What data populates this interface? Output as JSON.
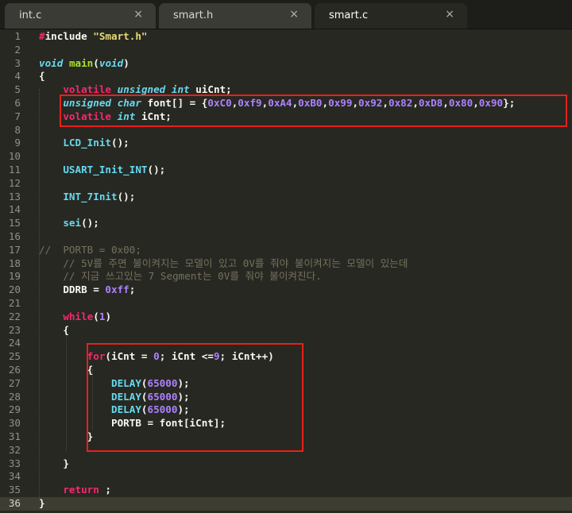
{
  "tabs": [
    {
      "label": "int.c",
      "close": "×"
    },
    {
      "label": "smart.h",
      "close": "×"
    },
    {
      "label": "smart.c",
      "close": "×",
      "active": true
    }
  ],
  "editor": {
    "current_line": 36,
    "lines": [
      {
        "n": "1",
        "t": [
          [
            "#",
            "kw"
          ],
          [
            "include ",
            ""
          ],
          [
            "\"Smart.h\"",
            "str"
          ]
        ]
      },
      {
        "n": "2",
        "t": []
      },
      {
        "n": "3",
        "t": [
          [
            "void",
            "ty"
          ],
          [
            " ",
            ""
          ],
          [
            "main",
            "fn"
          ],
          [
            "(",
            ""
          ],
          [
            "void",
            "ty"
          ],
          [
            ")",
            ""
          ]
        ]
      },
      {
        "n": "4",
        "t": [
          [
            "{",
            ""
          ]
        ]
      },
      {
        "n": "5",
        "t": [
          [
            "    ",
            ""
          ],
          [
            "volatile",
            "kw"
          ],
          [
            " ",
            ""
          ],
          [
            "unsigned",
            "ty"
          ],
          [
            " ",
            ""
          ],
          [
            "int",
            "ty"
          ],
          [
            " uiCnt;",
            ""
          ]
        ]
      },
      {
        "n": "6",
        "t": [
          [
            "    ",
            ""
          ],
          [
            "unsigned",
            "ty"
          ],
          [
            " ",
            ""
          ],
          [
            "char",
            "ty"
          ],
          [
            " font[] = {",
            ""
          ],
          [
            "0xC0",
            "num"
          ],
          [
            ",",
            ""
          ],
          [
            "0xf9",
            "num"
          ],
          [
            ",",
            ""
          ],
          [
            "0xA4",
            "num"
          ],
          [
            ",",
            ""
          ],
          [
            "0xB0",
            "num"
          ],
          [
            ",",
            ""
          ],
          [
            "0x99",
            "num"
          ],
          [
            ",",
            ""
          ],
          [
            "0x92",
            "num"
          ],
          [
            ",",
            ""
          ],
          [
            "0x82",
            "num"
          ],
          [
            ",",
            ""
          ],
          [
            "0xD8",
            "num"
          ],
          [
            ",",
            ""
          ],
          [
            "0x80",
            "num"
          ],
          [
            ",",
            ""
          ],
          [
            "0x90",
            "num"
          ],
          [
            "};",
            ""
          ]
        ]
      },
      {
        "n": "7",
        "t": [
          [
            "    ",
            ""
          ],
          [
            "volatile",
            "kw"
          ],
          [
            " ",
            ""
          ],
          [
            "int",
            "ty"
          ],
          [
            " iCnt;",
            ""
          ]
        ]
      },
      {
        "n": "8",
        "t": []
      },
      {
        "n": "9",
        "t": [
          [
            "    ",
            ""
          ],
          [
            "LCD_Init",
            "fn2"
          ],
          [
            "();",
            ""
          ]
        ]
      },
      {
        "n": "10",
        "t": []
      },
      {
        "n": "11",
        "t": [
          [
            "    ",
            ""
          ],
          [
            "USART_Init_INT",
            "fn2"
          ],
          [
            "();",
            ""
          ]
        ]
      },
      {
        "n": "12",
        "t": []
      },
      {
        "n": "13",
        "t": [
          [
            "    ",
            ""
          ],
          [
            "INT_7Init",
            "fn2"
          ],
          [
            "();",
            ""
          ]
        ]
      },
      {
        "n": "14",
        "t": []
      },
      {
        "n": "15",
        "t": [
          [
            "    ",
            ""
          ],
          [
            "sei",
            "fn2"
          ],
          [
            "();",
            ""
          ]
        ]
      },
      {
        "n": "16",
        "t": []
      },
      {
        "n": "17",
        "t": [
          [
            "//  PORTB = 0x00;",
            "cm"
          ]
        ]
      },
      {
        "n": "18",
        "t": [
          [
            "    // 5V를 주면 불이켜지는 모델이 있고 0V를 줘야 불이켜지는 모델이 있는데",
            "cm"
          ]
        ]
      },
      {
        "n": "19",
        "t": [
          [
            "    // 지금 쓰고있는 7 Segment는 0V를 줘야 불이켜진다.",
            "cm"
          ]
        ]
      },
      {
        "n": "20",
        "t": [
          [
            "    DDRB = ",
            ""
          ],
          [
            "0xff",
            "num"
          ],
          [
            ";",
            ""
          ]
        ]
      },
      {
        "n": "21",
        "t": []
      },
      {
        "n": "22",
        "t": [
          [
            "    ",
            ""
          ],
          [
            "while",
            "kw"
          ],
          [
            "(",
            ""
          ],
          [
            "1",
            "num"
          ],
          [
            ")",
            ""
          ]
        ]
      },
      {
        "n": "23",
        "t": [
          [
            "    {",
            ""
          ]
        ]
      },
      {
        "n": "24",
        "t": []
      },
      {
        "n": "25",
        "t": [
          [
            "        ",
            ""
          ],
          [
            "for",
            "kw"
          ],
          [
            "(iCnt = ",
            ""
          ],
          [
            "0",
            "num"
          ],
          [
            "; iCnt <=",
            ""
          ],
          [
            "9",
            "num"
          ],
          [
            "; iCnt++)",
            ""
          ]
        ]
      },
      {
        "n": "26",
        "t": [
          [
            "        {",
            ""
          ]
        ]
      },
      {
        "n": "27",
        "t": [
          [
            "            ",
            ""
          ],
          [
            "DELAY",
            "fn2"
          ],
          [
            "(",
            ""
          ],
          [
            "65000",
            "num"
          ],
          [
            ");",
            ""
          ]
        ]
      },
      {
        "n": "28",
        "t": [
          [
            "            ",
            ""
          ],
          [
            "DELAY",
            "fn2"
          ],
          [
            "(",
            ""
          ],
          [
            "65000",
            "num"
          ],
          [
            ");",
            ""
          ]
        ]
      },
      {
        "n": "29",
        "t": [
          [
            "            ",
            ""
          ],
          [
            "DELAY",
            "fn2"
          ],
          [
            "(",
            ""
          ],
          [
            "65000",
            "num"
          ],
          [
            ");",
            ""
          ]
        ]
      },
      {
        "n": "30",
        "t": [
          [
            "            PORTB = font[iCnt];",
            ""
          ]
        ]
      },
      {
        "n": "31",
        "t": [
          [
            "        }",
            ""
          ]
        ]
      },
      {
        "n": "32",
        "t": []
      },
      {
        "n": "33",
        "t": [
          [
            "    }",
            ""
          ]
        ]
      },
      {
        "n": "34",
        "t": []
      },
      {
        "n": "35",
        "t": [
          [
            "    ",
            ""
          ],
          [
            "return",
            "kw"
          ],
          [
            " ;",
            ""
          ]
        ]
      },
      {
        "n": "36",
        "t": [
          [
            "}",
            ""
          ]
        ]
      }
    ]
  },
  "highlight_color": "#e8201c"
}
